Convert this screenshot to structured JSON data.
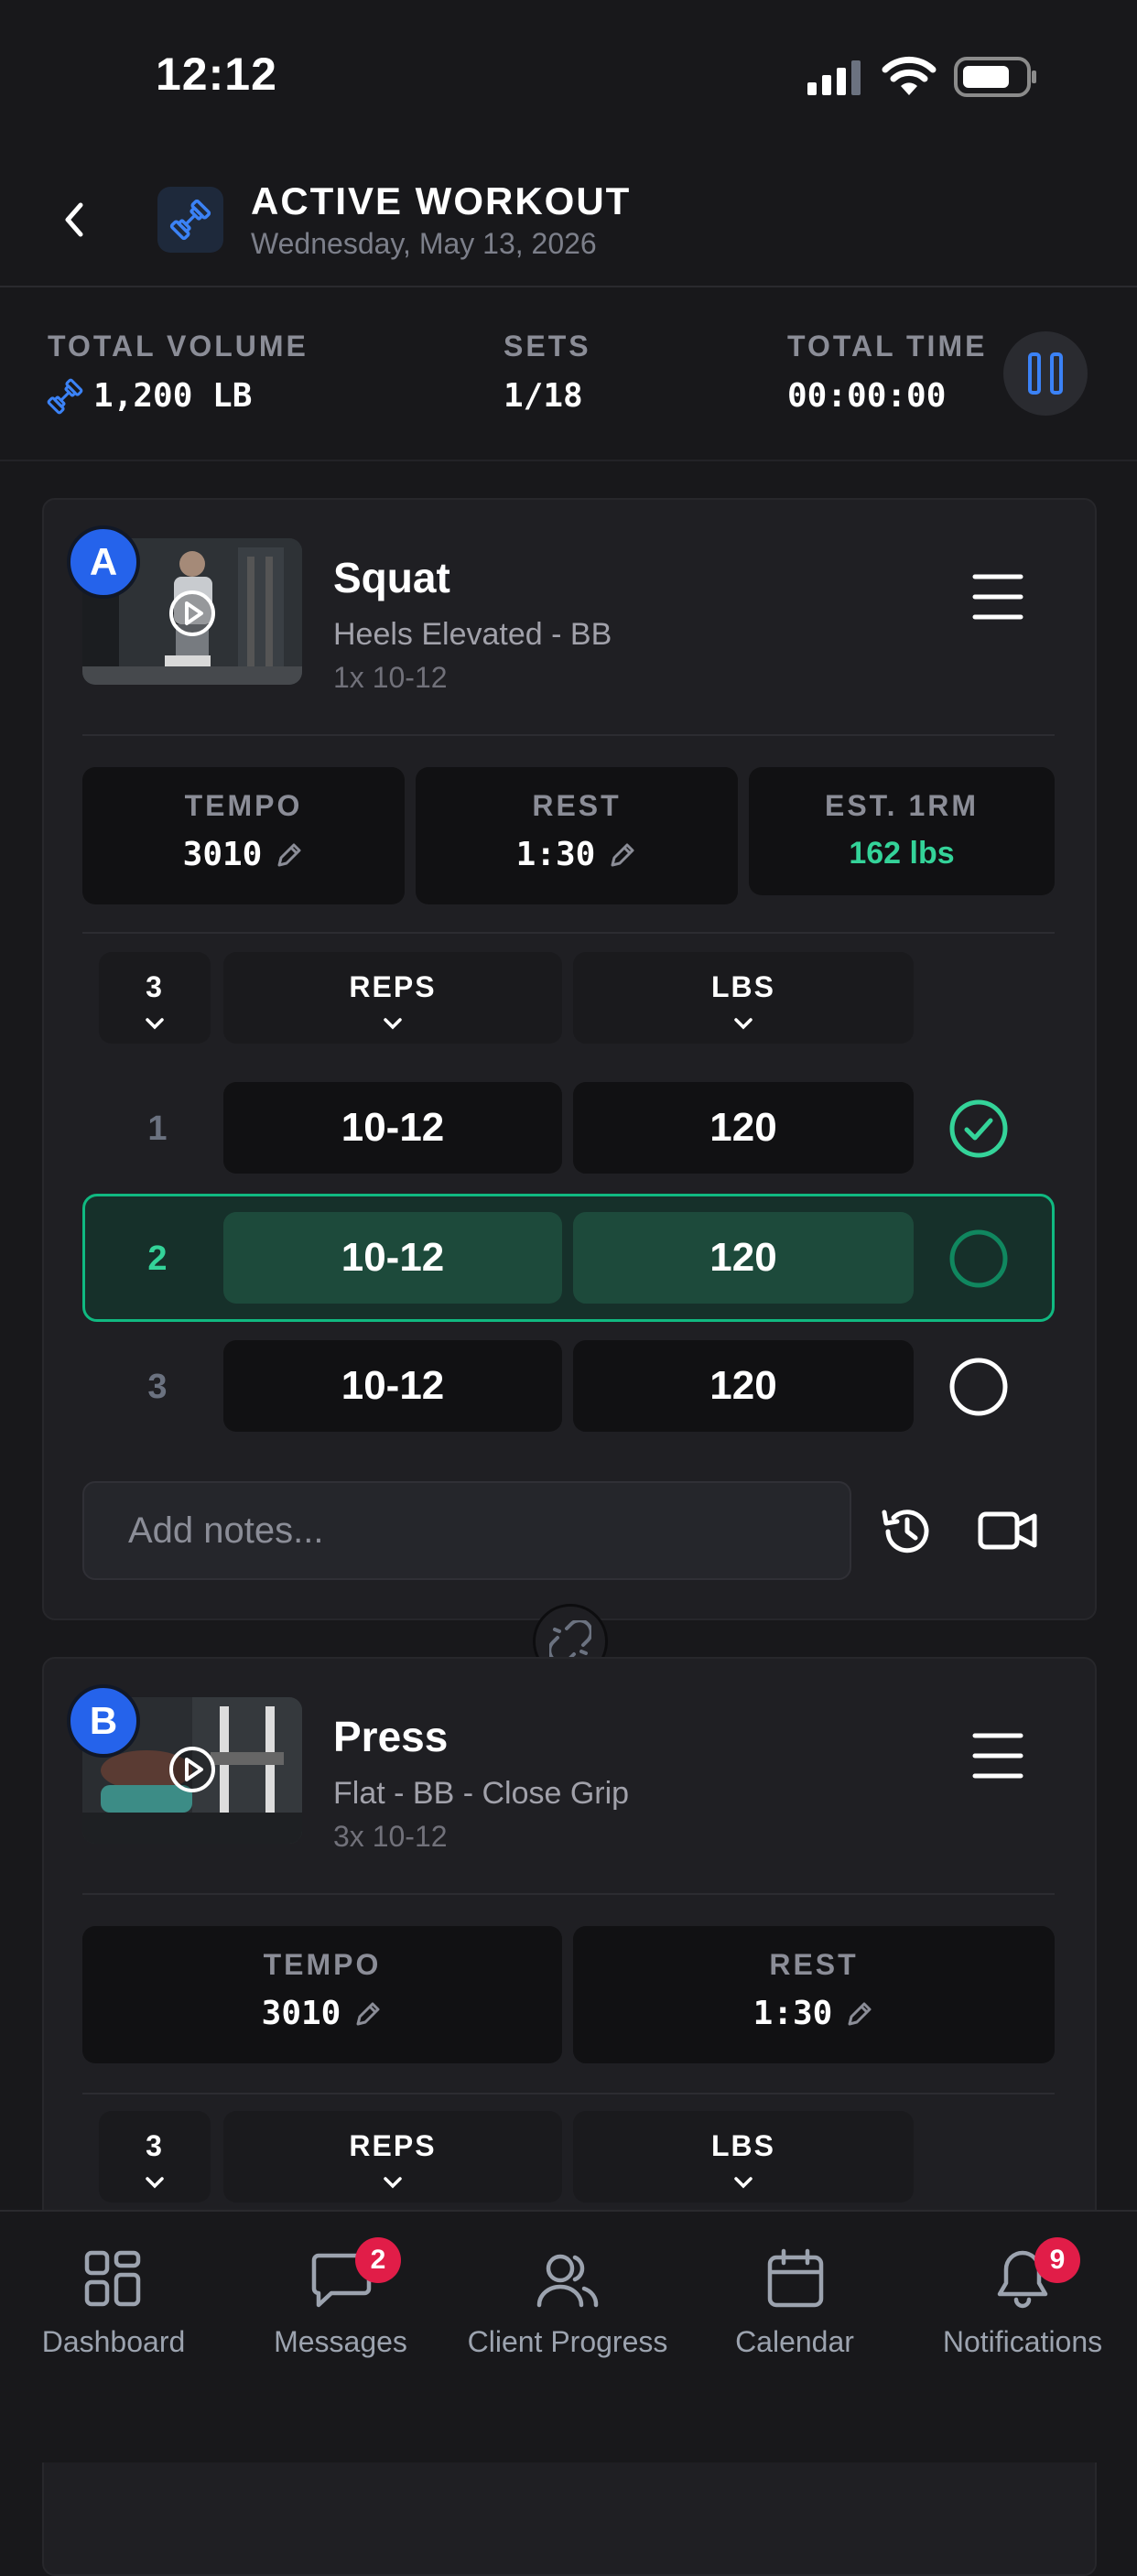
{
  "status_bar": {
    "time": "12:12"
  },
  "header": {
    "title": "ACTIVE WORKOUT",
    "date": "Wednesday, May 13, 2026"
  },
  "stats": {
    "volume_label": "TOTAL VOLUME",
    "volume_value": "1,200 LB",
    "sets_label": "SETS",
    "sets_value": "1/18",
    "time_label": "TOTAL TIME",
    "time_value": "00:00:00"
  },
  "exercises": [
    {
      "letter": "A",
      "name": "Squat",
      "variant": "Heels Elevated - BB",
      "scheme": "1x 10-12",
      "tempo_label": "TEMPO",
      "tempo_value": "3010",
      "rest_label": "REST",
      "rest_value": "1:30",
      "est_label": "EST. 1RM",
      "est_value": "162 lbs",
      "set_count": "3",
      "reps_label": "REPS",
      "lbs_label": "LBS",
      "sets": [
        {
          "num": "1",
          "reps": "10-12",
          "lbs": "120",
          "status": "done"
        },
        {
          "num": "2",
          "reps": "10-12",
          "lbs": "120",
          "status": "active"
        },
        {
          "num": "3",
          "reps": "10-12",
          "lbs": "120",
          "status": "pending"
        }
      ],
      "notes_placeholder": "Add notes..."
    },
    {
      "letter": "B",
      "name": "Press",
      "variant": "Flat - BB - Close Grip",
      "scheme": "3x 10-12",
      "tempo_label": "TEMPO",
      "tempo_value": "3010",
      "rest_label": "REST",
      "rest_value": "1:30",
      "set_count": "3",
      "reps_label": "REPS",
      "lbs_label": "LBS"
    }
  ],
  "nav": [
    {
      "label": "Dashboard",
      "icon": "dashboard-icon",
      "badge": ""
    },
    {
      "label": "Messages",
      "icon": "chat-icon",
      "badge": "2"
    },
    {
      "label": "Client Progress",
      "icon": "users-icon",
      "badge": ""
    },
    {
      "label": "Calendar",
      "icon": "calendar-icon",
      "badge": ""
    },
    {
      "label": "Notifications",
      "icon": "bell-icon",
      "badge": "9"
    }
  ],
  "colors": {
    "accent": "#2563eb",
    "success": "#34d399",
    "background": "#18181b"
  }
}
